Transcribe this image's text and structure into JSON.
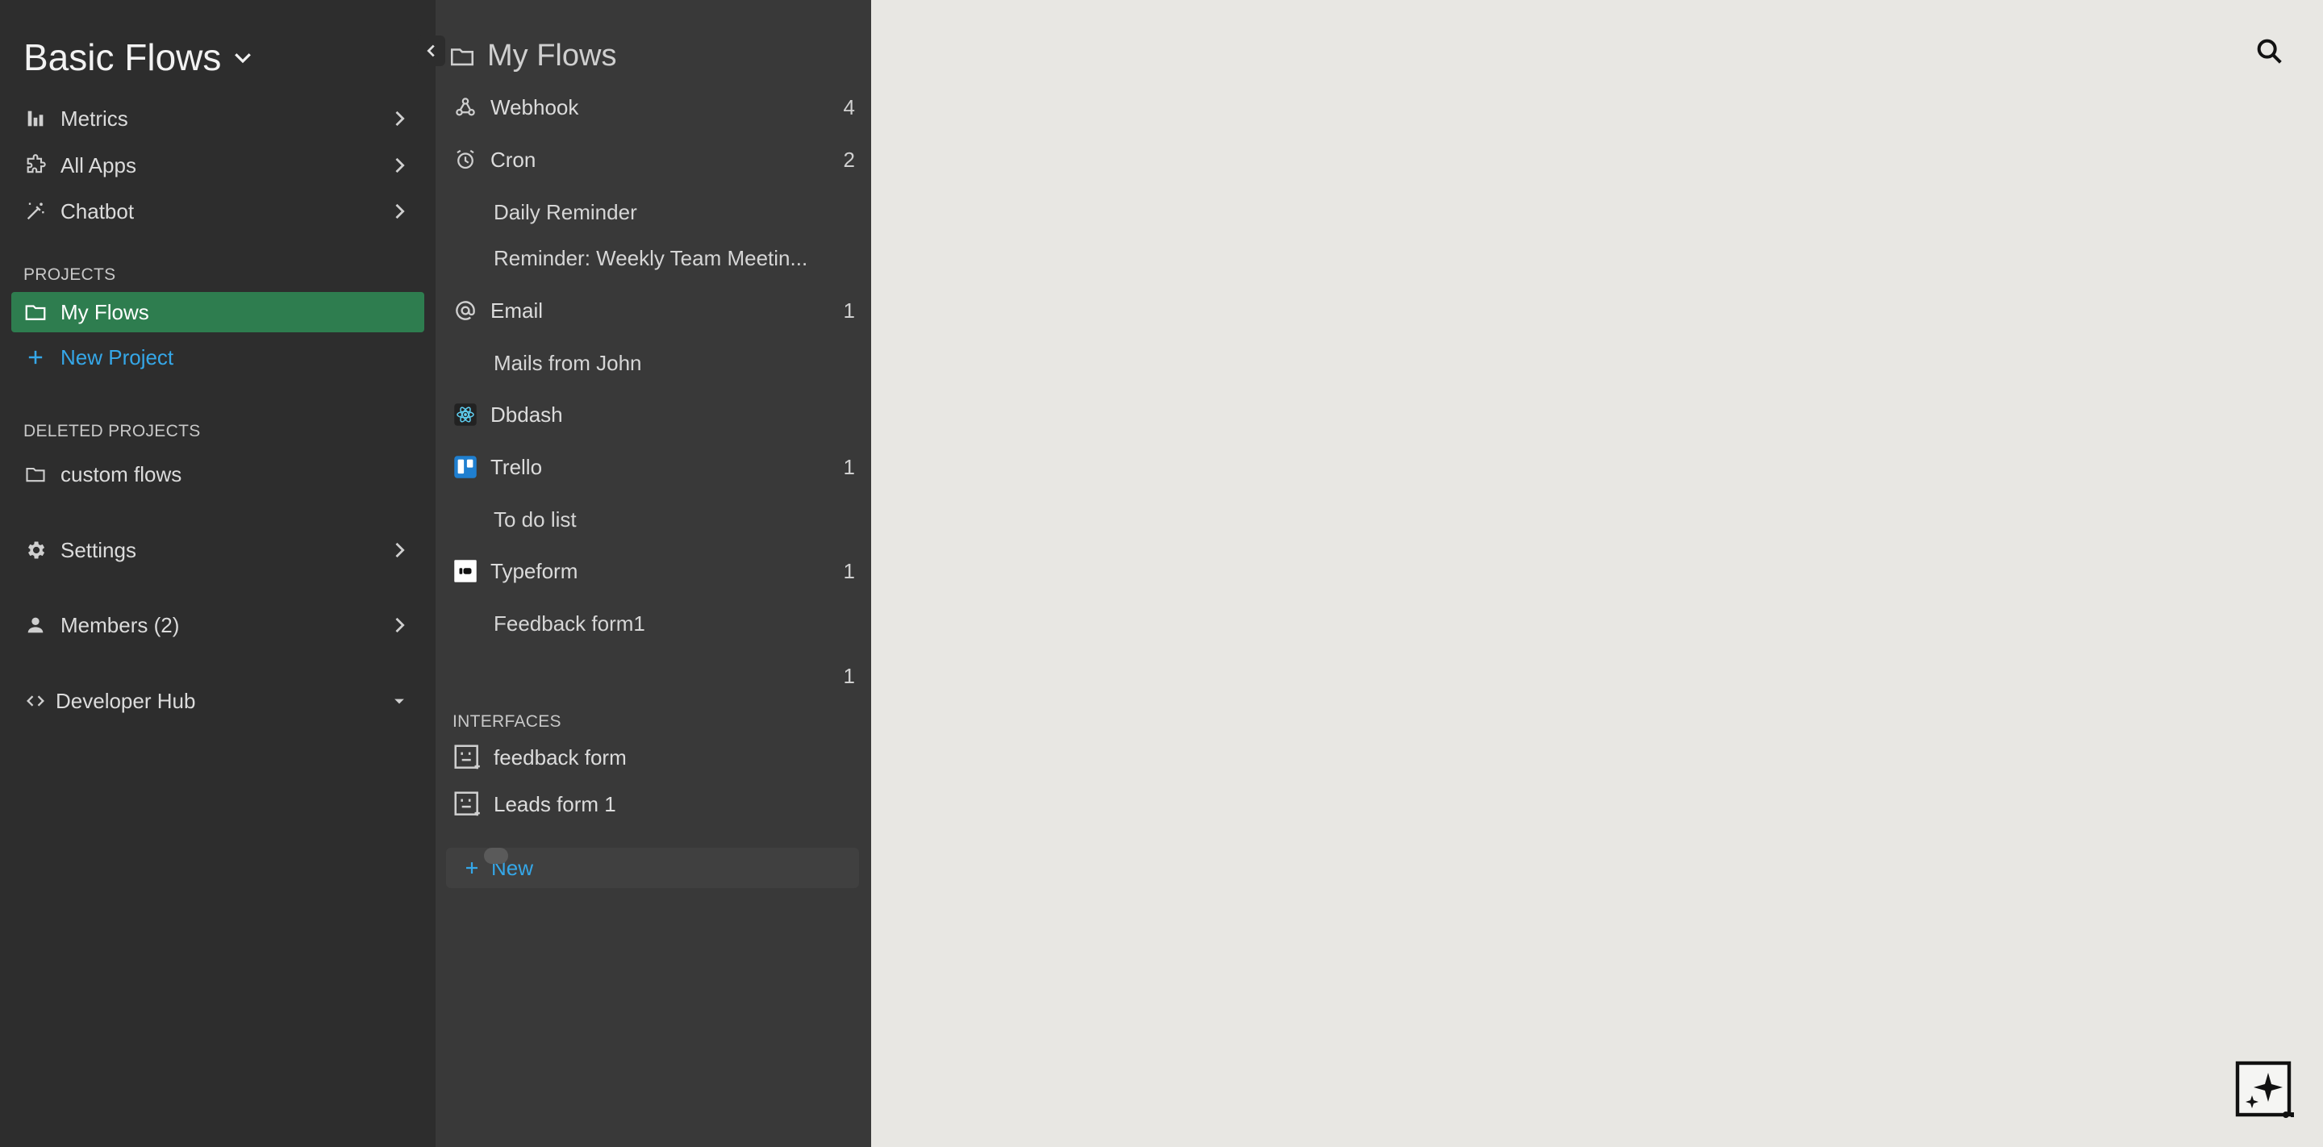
{
  "workspace": {
    "title": "Basic Flows"
  },
  "nav": {
    "metrics": "Metrics",
    "all_apps": "All Apps",
    "chatbot": "Chatbot"
  },
  "projects": {
    "section_label": "PROJECTS",
    "active": "My Flows",
    "new_project": "New Project"
  },
  "deleted_projects": {
    "section_label": "DELETED PROJECTS",
    "items": [
      "custom flows"
    ]
  },
  "settings": {
    "label": "Settings"
  },
  "members": {
    "label": "Members (2)"
  },
  "developer_hub": {
    "label": "Developer Hub"
  },
  "flows_panel": {
    "title": "My Flows",
    "triggers": [
      {
        "name": "Webhook",
        "count": "4",
        "icon": "webhook-icon"
      },
      {
        "name": "Cron",
        "count": "2",
        "icon": "alarm-clock-icon"
      },
      {
        "name": "Email",
        "count": "1",
        "icon": "at-sign-icon"
      },
      {
        "name": "Dbdash",
        "count": "",
        "icon": "dbdash-logo-icon"
      },
      {
        "name": "Trello",
        "count": "1",
        "icon": "trello-logo-icon"
      },
      {
        "name": "Typeform",
        "count": "1",
        "icon": "typeform-logo-icon"
      },
      {
        "name": "",
        "count": "1",
        "icon": ""
      }
    ],
    "flows": {
      "cron": [
        "Daily Reminder",
        "Reminder: Weekly Team Meetin..."
      ],
      "email": [
        "Mails from John"
      ],
      "trello": [
        "To do list"
      ],
      "typeform": [
        "Feedback form1"
      ]
    },
    "interfaces_label": "INTERFACES",
    "interfaces": [
      "feedback form",
      "Leads form 1"
    ],
    "new_label": "New"
  },
  "colors": {
    "sidebar_bg": "#2d2d2d",
    "panel_bg": "#393939",
    "main_bg": "#e8e7e3",
    "active_project": "#2e7d4f",
    "accent_link": "#35a7e8"
  }
}
